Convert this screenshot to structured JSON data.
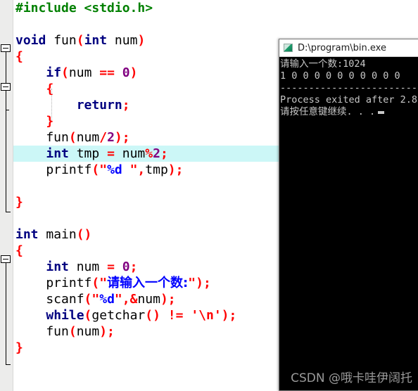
{
  "editor": {
    "name": "code-editor",
    "gutter_present": true,
    "highlight_color": "#ccf7f7",
    "highlighted_line_index": 9,
    "colors": {
      "preprocessor": "#008000",
      "keyword": "#000080",
      "identifier": "#000000",
      "punctuation": "#ff0000",
      "number": "#800080",
      "string": "#0000ff",
      "background": "#ffffff",
      "gutter": "#ececeb"
    },
    "lines": [
      {
        "text": "#include <stdio.h>",
        "tokens": [
          {
            "t": "#include <stdio.h>",
            "c": "pre"
          }
        ]
      },
      {
        "text": "",
        "tokens": []
      },
      {
        "text": "void fun(int num)",
        "tokens": [
          {
            "t": "void",
            "c": "kw"
          },
          {
            "t": " fun",
            "c": "id"
          },
          {
            "t": "(",
            "c": "pun"
          },
          {
            "t": "int",
            "c": "kw"
          },
          {
            "t": " num",
            "c": "id"
          },
          {
            "t": ")",
            "c": "pun"
          }
        ]
      },
      {
        "text": "{",
        "tokens": [
          {
            "t": "{",
            "c": "brace"
          }
        ]
      },
      {
        "text": "    if(num == 0)",
        "tokens": [
          {
            "t": "    ",
            "c": "id"
          },
          {
            "t": "if",
            "c": "kw"
          },
          {
            "t": "(",
            "c": "pun"
          },
          {
            "t": "num ",
            "c": "id"
          },
          {
            "t": "==",
            "c": "op"
          },
          {
            "t": " ",
            "c": "id"
          },
          {
            "t": "0",
            "c": "num"
          },
          {
            "t": ")",
            "c": "pun"
          }
        ]
      },
      {
        "text": "    {",
        "tokens": [
          {
            "t": "    ",
            "c": "id"
          },
          {
            "t": "{",
            "c": "brace"
          }
        ]
      },
      {
        "text": "        return;",
        "tokens": [
          {
            "t": "        ",
            "c": "id"
          },
          {
            "t": "return",
            "c": "kw"
          },
          {
            "t": ";",
            "c": "pun"
          }
        ]
      },
      {
        "text": "    }",
        "tokens": [
          {
            "t": "    ",
            "c": "id"
          },
          {
            "t": "}",
            "c": "brace"
          }
        ]
      },
      {
        "text": "    fun(num/2);",
        "tokens": [
          {
            "t": "    fun",
            "c": "id"
          },
          {
            "t": "(",
            "c": "pun"
          },
          {
            "t": "num",
            "c": "id"
          },
          {
            "t": "/",
            "c": "op"
          },
          {
            "t": "2",
            "c": "num"
          },
          {
            "t": ");",
            "c": "pun"
          }
        ]
      },
      {
        "text": "    int tmp = num%2;",
        "tokens": [
          {
            "t": "    ",
            "c": "id"
          },
          {
            "t": "int",
            "c": "kw"
          },
          {
            "t": " tmp ",
            "c": "id"
          },
          {
            "t": "=",
            "c": "op"
          },
          {
            "t": " num",
            "c": "id"
          },
          {
            "t": "%",
            "c": "op"
          },
          {
            "t": "2",
            "c": "num"
          },
          {
            "t": ";",
            "c": "pun"
          }
        ]
      },
      {
        "text": "    printf(\"%d \",tmp);",
        "tokens": [
          {
            "t": "    printf",
            "c": "id"
          },
          {
            "t": "(\"",
            "c": "pun"
          },
          {
            "t": "%d ",
            "c": "str"
          },
          {
            "t": "\",",
            "c": "pun"
          },
          {
            "t": "tmp",
            "c": "id"
          },
          {
            "t": ");",
            "c": "pun"
          }
        ]
      },
      {
        "text": "",
        "tokens": []
      },
      {
        "text": "}",
        "tokens": [
          {
            "t": "}",
            "c": "brace"
          }
        ]
      },
      {
        "text": "",
        "tokens": []
      },
      {
        "text": "int main()",
        "tokens": [
          {
            "t": "int",
            "c": "kw"
          },
          {
            "t": " main",
            "c": "id"
          },
          {
            "t": "()",
            "c": "pun"
          }
        ]
      },
      {
        "text": "{",
        "tokens": [
          {
            "t": "{",
            "c": "brace"
          }
        ]
      },
      {
        "text": "    int num = 0;",
        "tokens": [
          {
            "t": "    ",
            "c": "id"
          },
          {
            "t": "int",
            "c": "kw"
          },
          {
            "t": " num ",
            "c": "id"
          },
          {
            "t": "=",
            "c": "op"
          },
          {
            "t": " ",
            "c": "id"
          },
          {
            "t": "0",
            "c": "num"
          },
          {
            "t": ";",
            "c": "pun"
          }
        ]
      },
      {
        "text": "    printf(\"请输入一个数:\");",
        "tokens": [
          {
            "t": "    printf",
            "c": "id"
          },
          {
            "t": "(\"",
            "c": "pun"
          },
          {
            "t": "请输入一个数:",
            "c": "str cjk"
          },
          {
            "t": "\"",
            "c": "pun"
          },
          {
            "t": ");",
            "c": "pun"
          }
        ]
      },
      {
        "text": "    scanf(\"%d\",&num);",
        "tokens": [
          {
            "t": "    scanf",
            "c": "id"
          },
          {
            "t": "(\"",
            "c": "pun"
          },
          {
            "t": "%d",
            "c": "str"
          },
          {
            "t": "\",",
            "c": "pun"
          },
          {
            "t": "&",
            "c": "op"
          },
          {
            "t": "num",
            "c": "id"
          },
          {
            "t": ");",
            "c": "pun"
          }
        ]
      },
      {
        "text": "    while(getchar() != '\\n');",
        "tokens": [
          {
            "t": "    ",
            "c": "id"
          },
          {
            "t": "while",
            "c": "kw"
          },
          {
            "t": "(",
            "c": "pun"
          },
          {
            "t": "getchar",
            "c": "id"
          },
          {
            "t": "()",
            "c": "pun"
          },
          {
            "t": " ",
            "c": "id"
          },
          {
            "t": "!=",
            "c": "op"
          },
          {
            "t": " ",
            "c": "id"
          },
          {
            "t": "'\\n'",
            "c": "pun"
          },
          {
            "t": ");",
            "c": "pun"
          }
        ]
      },
      {
        "text": "    fun(num);",
        "tokens": [
          {
            "t": "    fun",
            "c": "id"
          },
          {
            "t": "(",
            "c": "pun"
          },
          {
            "t": "num",
            "c": "id"
          },
          {
            "t": ");",
            "c": "pun"
          }
        ]
      },
      {
        "text": "}",
        "tokens": [
          {
            "t": "}",
            "c": "brace"
          }
        ]
      }
    ]
  },
  "console": {
    "title": "D:\\program\\bin.exe",
    "icon": "console-app-icon",
    "background": "#000000",
    "text_color": "#c8c8c8",
    "lines": [
      "请输入一个数:1024",
      "1 0 0 0 0 0 0 0 0 0 0",
      "--------------------------------",
      "Process exited after 2.8",
      "请按任意键继续. . ."
    ]
  },
  "watermark": {
    "text": "CSDN @哦卡哇伊阔托"
  }
}
